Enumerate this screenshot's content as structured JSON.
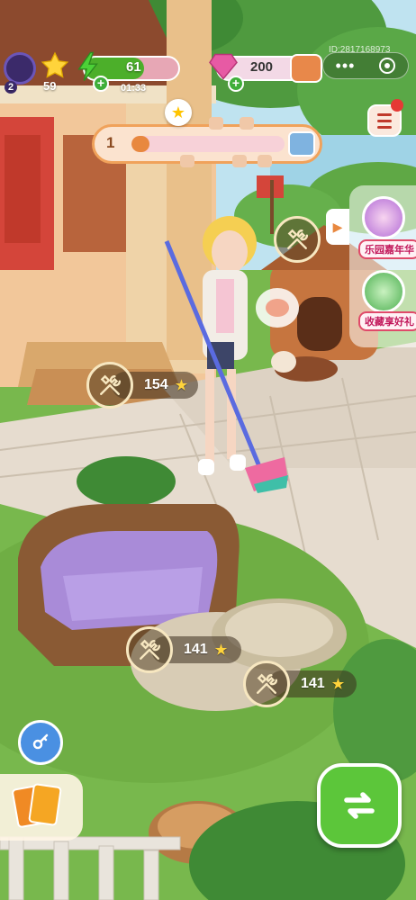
{
  "hud": {
    "level": "2",
    "stars": "59",
    "energy": {
      "value": "61",
      "timer": "01:33"
    },
    "gems": "200",
    "player_id": "ID:2817168973"
  },
  "progress": {
    "level": "1",
    "fill_fraction": 0.12
  },
  "tasks": [
    {
      "cost": "154"
    },
    {
      "cost": "141"
    },
    {
      "cost": "141"
    }
  ],
  "events": [
    {
      "label": "乐园嘉年华"
    },
    {
      "label": "收藏享好礼"
    }
  ],
  "colors": {
    "accent_green": "#3fae3a",
    "energy_bar": "#4caf2a",
    "gem_pink": "#e75aa4",
    "progress_fill": "#f2a6b6",
    "event_border": "#e04a6a"
  },
  "icons": {
    "menu": "menu-icon",
    "more": "more-icon",
    "record": "target-icon",
    "key": "key-icon",
    "cards": "cards-icon",
    "swap": "swap-arrows-icon"
  }
}
